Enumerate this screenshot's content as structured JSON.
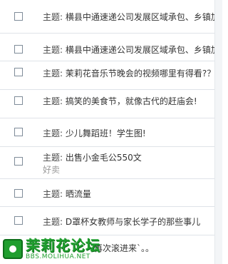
{
  "rows": [
    {
      "label": "主题:",
      "text": "横县中通速递公司发展区域承包、乡镇加"
    },
    {
      "label": "主题:",
      "text": "横县中通速递公司发展区域承包、乡镇加"
    },
    {
      "label": "主题:",
      "text": "茉莉花音乐节晚会的视频哪里有得看?？"
    },
    {
      "label": "主题:",
      "text": "搞笑的美食节，就像古代的赶庙会!"
    },
    {
      "label": "主题:",
      "text": "少儿舞蹈班！学生图!"
    },
    {
      "label": "主题:",
      "text": "出售小金毛公550文",
      "sub": "好卖"
    },
    {
      "label": "主题:",
      "text": "晒流量"
    },
    {
      "label": "主题:",
      "text": "D罩杯女教师与家长学子的那些事儿"
    }
  ],
  "last_row_tail": "再次滚进来`。。",
  "watermark": {
    "title": "茉莉花论坛",
    "url": "BBS.MOLIHUA.NET"
  }
}
